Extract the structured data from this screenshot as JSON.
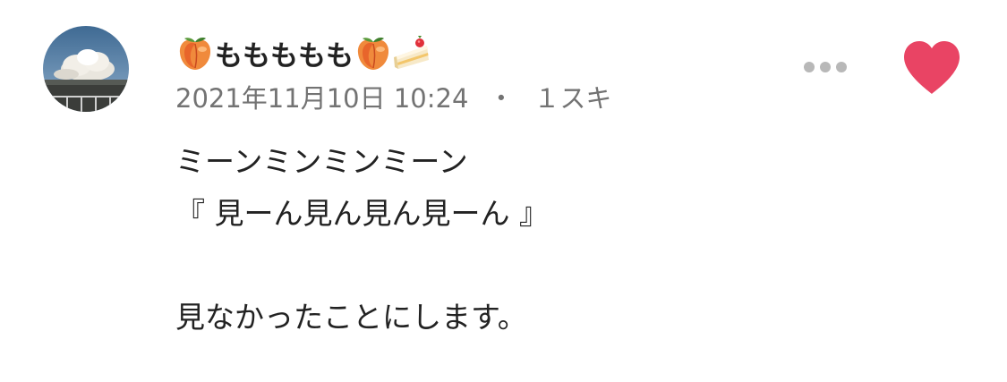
{
  "comment": {
    "author": {
      "emoji_prefix": "peach-emoji",
      "name": "ももももも",
      "emoji_suffix": [
        "peach-emoji",
        "shortcake-emoji"
      ]
    },
    "timestamp": "2021年11月10日 10:24",
    "separator": "・",
    "likes": "１スキ",
    "body_lines": [
      "ミーンミンミンミーン",
      "『 見ーん見ん見ん見ーん 』",
      "",
      "見なかったことにします。"
    ]
  },
  "icons": {
    "more": "more-horizontal-icon",
    "like": "heart-icon"
  },
  "colors": {
    "heart": "#e94464",
    "meta_text": "#737373",
    "more_dots": "#b8b8b8",
    "body_text": "#222222"
  }
}
